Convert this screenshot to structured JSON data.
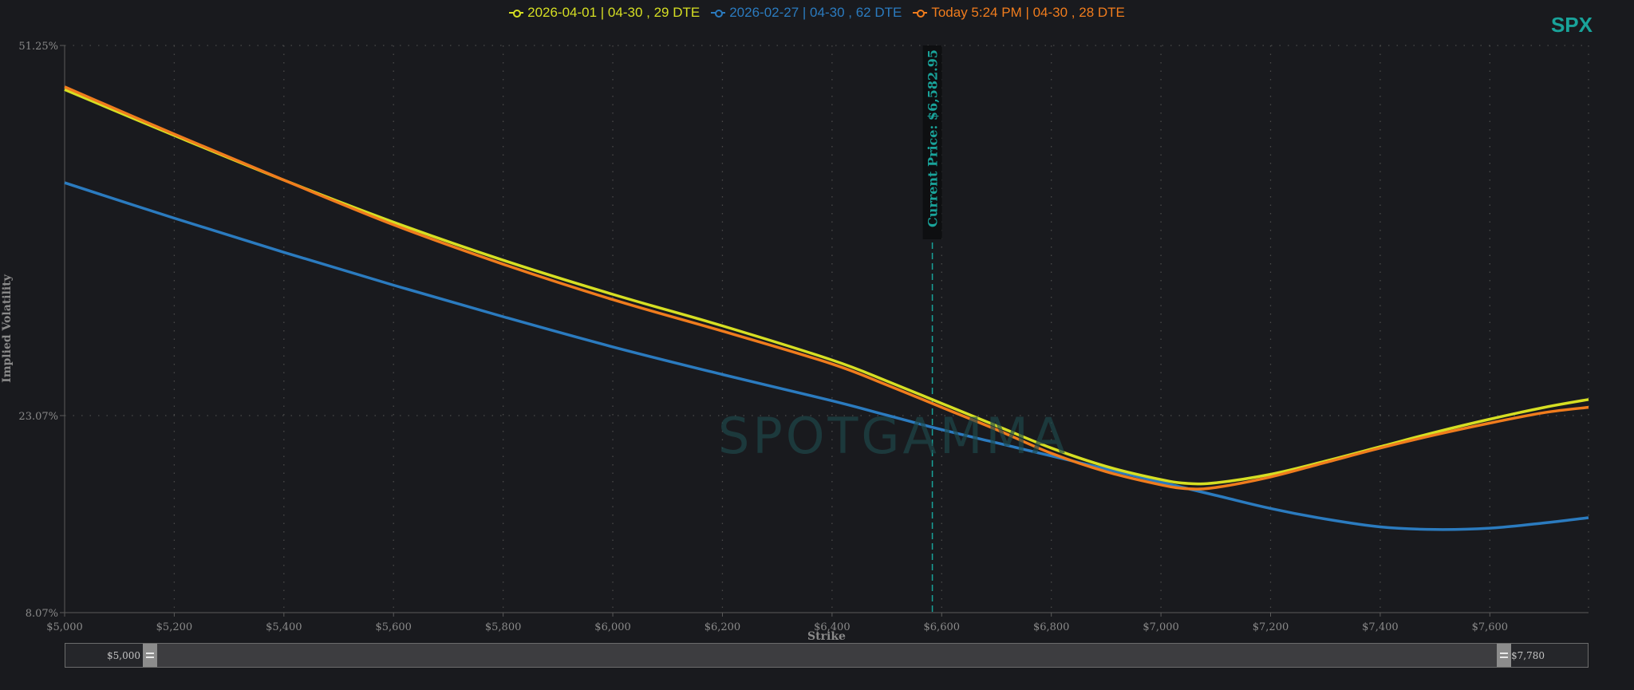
{
  "ticker": "SPX",
  "watermark": "SPOTGAMMA",
  "legend": [
    {
      "label": "2026-04-01 | 04-30 , 29 DTE",
      "color": "#d6df23"
    },
    {
      "label": "2026-02-27 | 04-30 , 62 DTE",
      "color": "#2b7bbf"
    },
    {
      "label": "Today 5:24 PM | 04-30 , 28 DTE",
      "color": "#f07c1d"
    }
  ],
  "range_slider": {
    "min_label": "$5,000",
    "max_label": "$7,780"
  },
  "chart_data": {
    "type": "line",
    "xlabel": "Strike",
    "ylabel": "Implied Volatility",
    "xlim": [
      5000,
      7780
    ],
    "ylim": [
      8.07,
      51.25
    ],
    "y_ticks": [
      8.07,
      23.07,
      51.25
    ],
    "y_tick_labels": [
      "8.07%",
      "23.07%",
      "51.25%"
    ],
    "x_ticks": [
      5000,
      5200,
      5400,
      5600,
      5800,
      6000,
      6200,
      6400,
      6600,
      6800,
      7000,
      7200,
      7400,
      7600
    ],
    "x_tick_labels": [
      "$5,000",
      "$5,200",
      "$5,400",
      "$5,600",
      "$5,800",
      "$6,000",
      "$6,200",
      "$6,400",
      "$6,600",
      "$6,800",
      "$7,000",
      "$7,200",
      "$7,400",
      "$7,600"
    ],
    "grid": true,
    "current_price": {
      "value": 6582.95,
      "label": "Current Price: $6,582.95"
    },
    "series": [
      {
        "name": "2026-04-01 | 04-30 , 29 DTE",
        "color": "#d6df23",
        "x": [
          5000,
          5200,
          5400,
          5600,
          5800,
          6000,
          6200,
          6400,
          6500,
          6600,
          6700,
          6800,
          6900,
          7000,
          7050,
          7100,
          7200,
          7300,
          7400,
          7500,
          7600,
          7700,
          7780
        ],
        "y": [
          47.9,
          44.4,
          41.0,
          37.8,
          34.9,
          32.3,
          29.9,
          27.3,
          25.7,
          24.0,
          22.3,
          20.6,
          19.2,
          18.2,
          17.9,
          17.95,
          18.6,
          19.6,
          20.7,
          21.8,
          22.8,
          23.7,
          24.3
        ]
      },
      {
        "name": "2026-02-27 | 04-30 , 62 DTE",
        "color": "#2b7bbf",
        "x": [
          5000,
          5200,
          5400,
          5600,
          5800,
          6000,
          6200,
          6400,
          6500,
          6600,
          6700,
          6800,
          6900,
          7000,
          7100,
          7200,
          7300,
          7400,
          7500,
          7600,
          7700,
          7780
        ],
        "y": [
          40.8,
          38.1,
          35.5,
          33.0,
          30.6,
          28.3,
          26.2,
          24.2,
          23.1,
          22.0,
          21.0,
          20.0,
          19.0,
          18.0,
          17.0,
          16.0,
          15.2,
          14.6,
          14.4,
          14.5,
          14.9,
          15.3
        ]
      },
      {
        "name": "Today 5:24 PM | 04-30 , 28 DTE",
        "color": "#f07c1d",
        "x": [
          5000,
          5200,
          5400,
          5600,
          5800,
          6000,
          6200,
          6400,
          6500,
          6600,
          6700,
          6800,
          6900,
          7000,
          7050,
          7100,
          7200,
          7300,
          7400,
          7500,
          7600,
          7700,
          7780
        ],
        "y": [
          48.1,
          44.5,
          41.0,
          37.6,
          34.6,
          31.9,
          29.5,
          27.0,
          25.4,
          23.7,
          22.0,
          20.2,
          18.8,
          17.8,
          17.5,
          17.6,
          18.4,
          19.5,
          20.6,
          21.6,
          22.5,
          23.3,
          23.7
        ]
      }
    ]
  }
}
